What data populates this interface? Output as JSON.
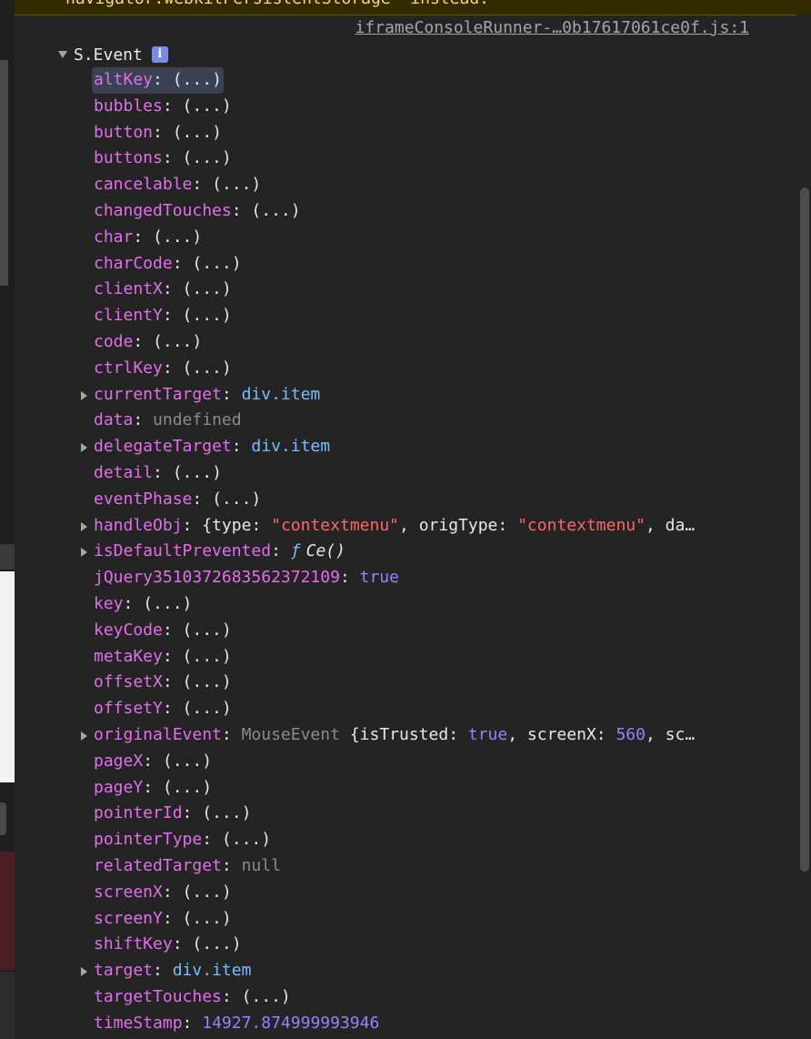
{
  "warning": {
    "text": "navigator.webkitPersistentStorage' instead."
  },
  "source_link": "iframeConsoleRunner-…0b17617061ce0f.js:1",
  "object": {
    "label": "S.Event",
    "info_icon": "i",
    "properties": [
      {
        "key": "altKey",
        "value": "(...)",
        "type": "getter",
        "selected": true,
        "expandable": false
      },
      {
        "key": "bubbles",
        "value": "(...)",
        "type": "getter",
        "expandable": false
      },
      {
        "key": "button",
        "value": "(...)",
        "type": "getter",
        "expandable": false
      },
      {
        "key": "buttons",
        "value": "(...)",
        "type": "getter",
        "expandable": false
      },
      {
        "key": "cancelable",
        "value": "(...)",
        "type": "getter",
        "expandable": false
      },
      {
        "key": "changedTouches",
        "value": "(...)",
        "type": "getter",
        "expandable": false
      },
      {
        "key": "char",
        "value": "(...)",
        "type": "getter",
        "expandable": false
      },
      {
        "key": "charCode",
        "value": "(...)",
        "type": "getter",
        "expandable": false
      },
      {
        "key": "clientX",
        "value": "(...)",
        "type": "getter",
        "expandable": false
      },
      {
        "key": "clientY",
        "value": "(...)",
        "type": "getter",
        "expandable": false
      },
      {
        "key": "code",
        "value": "(...)",
        "type": "getter",
        "expandable": false
      },
      {
        "key": "ctrlKey",
        "value": "(...)",
        "type": "getter",
        "expandable": false
      },
      {
        "key": "currentTarget",
        "value": "div.item",
        "type": "node",
        "expandable": true
      },
      {
        "key": "data",
        "value": "undefined",
        "type": "undefined",
        "expandable": false
      },
      {
        "key": "delegateTarget",
        "value": "div.item",
        "type": "node",
        "expandable": true
      },
      {
        "key": "detail",
        "value": "(...)",
        "type": "getter",
        "expandable": false
      },
      {
        "key": "eventPhase",
        "value": "(...)",
        "type": "getter",
        "expandable": false
      },
      {
        "key": "handleObj",
        "type": "object-preview",
        "expandable": true,
        "preview": {
          "open": "{",
          "k1": "type",
          "v1": "\"contextmenu\"",
          "k2": "origType",
          "v2": "\"contextmenu\"",
          "tail": "da…"
        }
      },
      {
        "key": "isDefaultPrevented",
        "value": "Ce()",
        "prefix": "ƒ",
        "type": "function",
        "expandable": true
      },
      {
        "key": "jQuery3510372683562372109",
        "value": "true",
        "type": "bool",
        "expandable": false
      },
      {
        "key": "key",
        "value": "(...)",
        "type": "getter",
        "expandable": false
      },
      {
        "key": "keyCode",
        "value": "(...)",
        "type": "getter",
        "expandable": false
      },
      {
        "key": "metaKey",
        "value": "(...)",
        "type": "getter",
        "expandable": false
      },
      {
        "key": "offsetX",
        "value": "(...)",
        "type": "getter",
        "expandable": false
      },
      {
        "key": "offsetY",
        "value": "(...)",
        "type": "getter",
        "expandable": false
      },
      {
        "key": "originalEvent",
        "type": "event-preview",
        "expandable": true,
        "preview": {
          "class": "MouseEvent",
          "open": "{",
          "k1": "isTrusted",
          "v1": "true",
          "k2": "screenX",
          "v2": "560",
          "tail": "sc…"
        }
      },
      {
        "key": "pageX",
        "value": "(...)",
        "type": "getter",
        "expandable": false
      },
      {
        "key": "pageY",
        "value": "(...)",
        "type": "getter",
        "expandable": false
      },
      {
        "key": "pointerId",
        "value": "(...)",
        "type": "getter",
        "expandable": false
      },
      {
        "key": "pointerType",
        "value": "(...)",
        "type": "getter",
        "expandable": false
      },
      {
        "key": "relatedTarget",
        "value": "null",
        "type": "undefined",
        "expandable": false
      },
      {
        "key": "screenX",
        "value": "(...)",
        "type": "getter",
        "expandable": false
      },
      {
        "key": "screenY",
        "value": "(...)",
        "type": "getter",
        "expandable": false
      },
      {
        "key": "shiftKey",
        "value": "(...)",
        "type": "getter",
        "expandable": false
      },
      {
        "key": "target",
        "value": "div.item",
        "type": "node",
        "expandable": true
      },
      {
        "key": "targetTouches",
        "value": "(...)",
        "type": "getter",
        "expandable": false
      },
      {
        "key": "timeStamp",
        "value": "14927.874999993946",
        "type": "number",
        "expandable": false
      }
    ]
  },
  "colors": {
    "background": "#242424",
    "property_key": "#e36eec",
    "node_value": "#75bfff",
    "string_value": "#ff6666",
    "keyword_value": "#9980ff",
    "muted_value": "#8b8b8b",
    "warning_text": "#ffd866"
  }
}
